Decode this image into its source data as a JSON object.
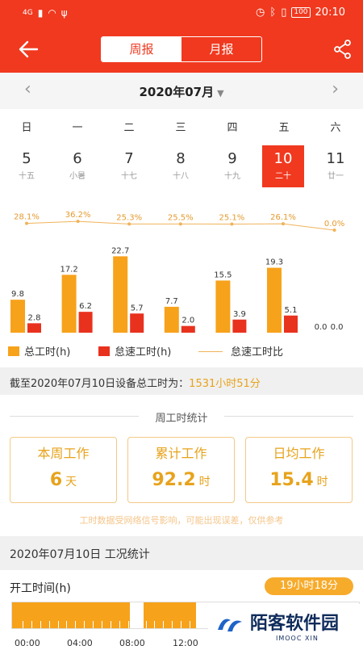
{
  "status_bar": {
    "signal": "4G",
    "time": "20:10",
    "battery": "100"
  },
  "header": {
    "tabs": [
      {
        "label": "周报",
        "active": true
      },
      {
        "label": "月报",
        "active": false
      }
    ]
  },
  "month_nav": {
    "title": "2020年07月"
  },
  "calendar": {
    "weekdays": [
      "日",
      "一",
      "二",
      "三",
      "四",
      "五",
      "六"
    ],
    "days": [
      {
        "num": "5",
        "lunar": "十五",
        "selected": false
      },
      {
        "num": "6",
        "lunar": "小暑",
        "selected": false
      },
      {
        "num": "7",
        "lunar": "十七",
        "selected": false
      },
      {
        "num": "8",
        "lunar": "十八",
        "selected": false
      },
      {
        "num": "9",
        "lunar": "十九",
        "selected": false
      },
      {
        "num": "10",
        "lunar": "二十",
        "selected": true
      },
      {
        "num": "11",
        "lunar": "廿一",
        "selected": false
      }
    ]
  },
  "chart_data": {
    "type": "bar",
    "categories": [
      "5",
      "6",
      "7",
      "8",
      "9",
      "10",
      "11"
    ],
    "series": [
      {
        "name": "总工时(h)",
        "values": [
          9.8,
          17.2,
          22.7,
          7.7,
          15.5,
          19.3,
          0.0
        ],
        "labels": [
          "9.8",
          "17.2",
          "22.7",
          "7.7",
          "15.5",
          "19.3",
          "0.0"
        ],
        "color": "#f7a21b"
      },
      {
        "name": "怠速工时(h)",
        "values": [
          2.8,
          6.2,
          5.7,
          2.0,
          3.9,
          5.1,
          0.0
        ],
        "labels": [
          "2.8",
          "6.2",
          "5.7",
          "2.0",
          "3.9",
          "5.1",
          "0.0"
        ],
        "color": "#e8321e"
      },
      {
        "name": "怠速工时比",
        "type": "line",
        "values": [
          28.1,
          36.2,
          25.3,
          25.5,
          25.1,
          26.1,
          0.0
        ],
        "labels": [
          "28.1%",
          "36.2%",
          "25.3%",
          "25.5%",
          "25.1%",
          "26.1%",
          "0.0%"
        ],
        "color": "#f0b35a"
      }
    ],
    "ylim": [
      0,
      24
    ],
    "grid": false,
    "legend": "bottom"
  },
  "summary": {
    "prefix": "截至2020年07月10日设备总工时为：",
    "value": "1531小时51分"
  },
  "weekly": {
    "title": "周工时统计",
    "cards": [
      {
        "title": "本周工作",
        "value": "6",
        "unit": "天"
      },
      {
        "title": "累计工作",
        "value": "92.2",
        "unit": "时"
      },
      {
        "title": "日均工作",
        "value": "15.4",
        "unit": "时"
      }
    ],
    "note": "工时数据受网络信号影响，可能出现误差，仅供参考"
  },
  "daily": {
    "title": "2020年07月10日 工况统计",
    "work_label": "开工时间(h)",
    "work_value": "19小时18分",
    "time_labels": [
      "00:00",
      "04:00",
      "08:00",
      "12:00"
    ],
    "segments": [
      [
        0.0,
        0.34
      ],
      [
        0.38,
        0.53
      ]
    ]
  },
  "watermark": {
    "text": "陌客软件园",
    "sub": "IMOOC XIN"
  },
  "colors": {
    "brand": "#f0391f",
    "accent": "#f7a21b",
    "idle": "#e8321e"
  }
}
